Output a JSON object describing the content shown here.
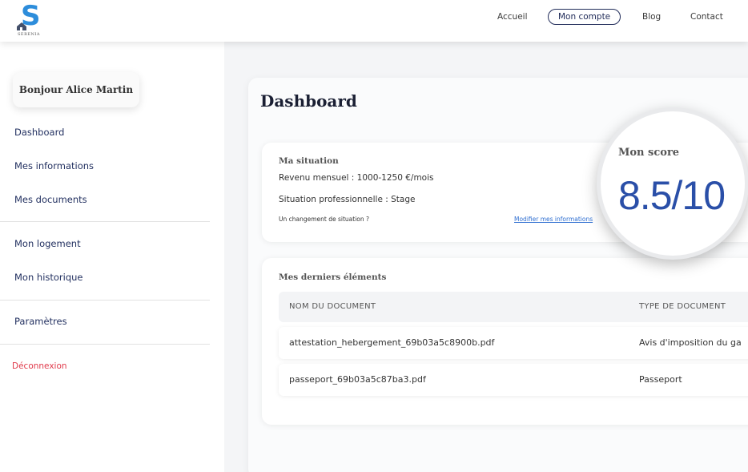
{
  "brand": {
    "logo_text": "SERENIA",
    "accent_color": "#2d8ddb"
  },
  "nav": {
    "items": [
      {
        "label": "Accueil"
      },
      {
        "label": "Mon compte",
        "active": true
      },
      {
        "label": "Blog"
      },
      {
        "label": "Contact"
      }
    ]
  },
  "sidebar": {
    "greeting": "Bonjour Alice Martin",
    "items": [
      {
        "label": "Dashboard"
      },
      {
        "label": "Mes informations"
      },
      {
        "label": "Mes documents"
      },
      {
        "label": "Mon logement"
      },
      {
        "label": "Mon historique"
      },
      {
        "label": "Paramètres"
      }
    ],
    "logout": "Déconnexion"
  },
  "main": {
    "title": "Dashboard",
    "situation": {
      "title": "Ma situation",
      "income": "Revenu mensuel : 1000-1250 €/mois",
      "professional": "Situation professionnelle : Stage",
      "change_prompt": "Un changement de situation ?",
      "edit_link": "Modifier mes informations"
    },
    "score": {
      "label": "Mon score",
      "value": "8.5/10",
      "color": "#2a4fa8"
    },
    "recent": {
      "title": "Mes derniers éléments",
      "columns": [
        "NOM DU DOCUMENT",
        "TYPE DE DOCUMENT"
      ],
      "rows": [
        {
          "name": "attestation_hebergement_69b03a5c8900b.pdf",
          "type": "Avis d'imposition du ga"
        },
        {
          "name": "passeport_69b03a5c87ba3.pdf",
          "type": "Passeport"
        }
      ]
    }
  }
}
